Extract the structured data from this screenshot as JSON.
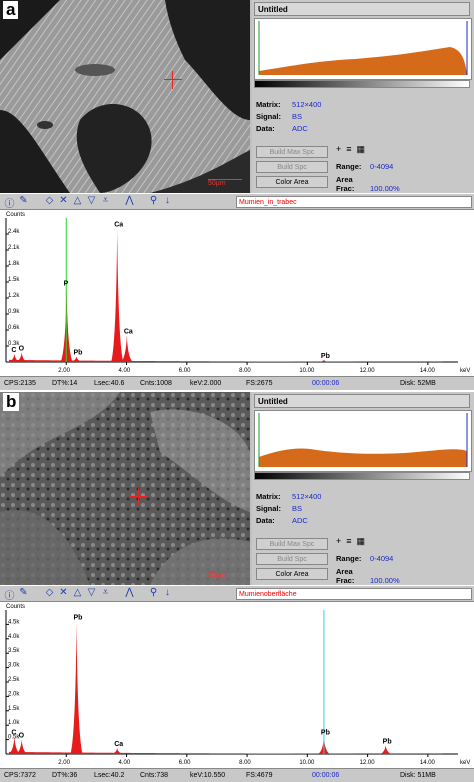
{
  "panels": [
    {
      "id": "a",
      "tag": "a",
      "scale_label": "50µm",
      "window_title": "Untitled",
      "matrix_label": "Matrix:",
      "matrix": "512×400",
      "signal_label": "Signal:",
      "signal": "BS",
      "data_label": "Data:",
      "data": "ADC",
      "btn_build_max": "Build Max Spc",
      "btn_build": "Build Spc",
      "btn_color": "Color Area",
      "range_label": "Range:",
      "range": "0-4094",
      "areafrac_label": "Area Frac:",
      "areafrac": "100.00%",
      "spectrum_label": "Mumien_in_trabec",
      "counts_label": "Counts",
      "y_ticks": [
        "2.4k",
        "2.1k",
        "1.8k",
        "1.5k",
        "1.2k",
        "0.9k",
        "0.6k",
        "0.3k"
      ],
      "x_ticks": [
        "2.00",
        "4.00",
        "6.00",
        "8.00",
        "10.00",
        "12.00",
        "14.00"
      ],
      "x_unit": "keV",
      "peaks": [
        "C",
        "O",
        "P",
        "Pb",
        "Ca",
        "Pb"
      ],
      "status": {
        "cps": "CPS:2135",
        "dt": "DT%:14",
        "lsec": "Lsec:40.6",
        "cnts": "Cnts:1008",
        "kev": "keV:2.000",
        "fs": "FS:2675",
        "time": "00:00:06",
        "disk": "Disk:  52MB"
      },
      "chart_data": {
        "type": "line",
        "x": [
          0.28,
          0.52,
          2.01,
          2.34,
          3.69,
          4.01,
          10.55
        ],
        "peak_labels": [
          "C",
          "O",
          "P",
          "Pb",
          "Ca",
          "Ca",
          "Pb"
        ],
        "values": [
          150,
          180,
          1400,
          100,
          2500,
          500,
          40
        ],
        "xlim": [
          0,
          15
        ],
        "ylim": [
          0,
          2700
        ],
        "cursor_kev": 2.0
      }
    },
    {
      "id": "b",
      "tag": "b",
      "scale_label": "20µm",
      "window_title": "Untitled",
      "matrix_label": "Matrix:",
      "matrix": "512×400",
      "signal_label": "Signal:",
      "signal": "BS",
      "data_label": "Data:",
      "data": "ADC",
      "btn_build_max": "Build Max Spc",
      "btn_build": "Build Spc",
      "btn_color": "Color Area",
      "range_label": "Range:",
      "range": "0-4094",
      "areafrac_label": "Area Frac:",
      "areafrac": "100.00%",
      "spectrum_label": "Mumienoberfläche",
      "counts_label": "Counts",
      "y_ticks": [
        "4.5k",
        "4.0k",
        "3.5k",
        "3.0k",
        "2.5k",
        "2.0k",
        "1.5k",
        "1.0k",
        "0.5k"
      ],
      "x_ticks": [
        "2.00",
        "4.00",
        "6.00",
        "8.00",
        "10.00",
        "12.00",
        "14.00"
      ],
      "x_unit": "keV",
      "peaks": [
        "C",
        "O",
        "Pb",
        "Ca",
        "Pb"
      ],
      "status": {
        "cps": "CPS:7372",
        "dt": "DT%:36",
        "lsec": "Lsec:40.2",
        "cnts": "Cnts:738",
        "kev": "keV:10.550",
        "fs": "FS:4679",
        "time": "00:00:06",
        "disk": "Disk:  51MB"
      },
      "chart_data": {
        "type": "line",
        "x": [
          0.28,
          0.52,
          2.34,
          3.69,
          10.55,
          12.6
        ],
        "peak_labels": [
          "C",
          "O",
          "Pb",
          "Ca",
          "Pb",
          "Pb"
        ],
        "values": [
          600,
          500,
          4600,
          200,
          600,
          300
        ],
        "xlim": [
          0,
          15
        ],
        "ylim": [
          0,
          5000
        ],
        "cursor_kev": 10.55
      }
    }
  ]
}
